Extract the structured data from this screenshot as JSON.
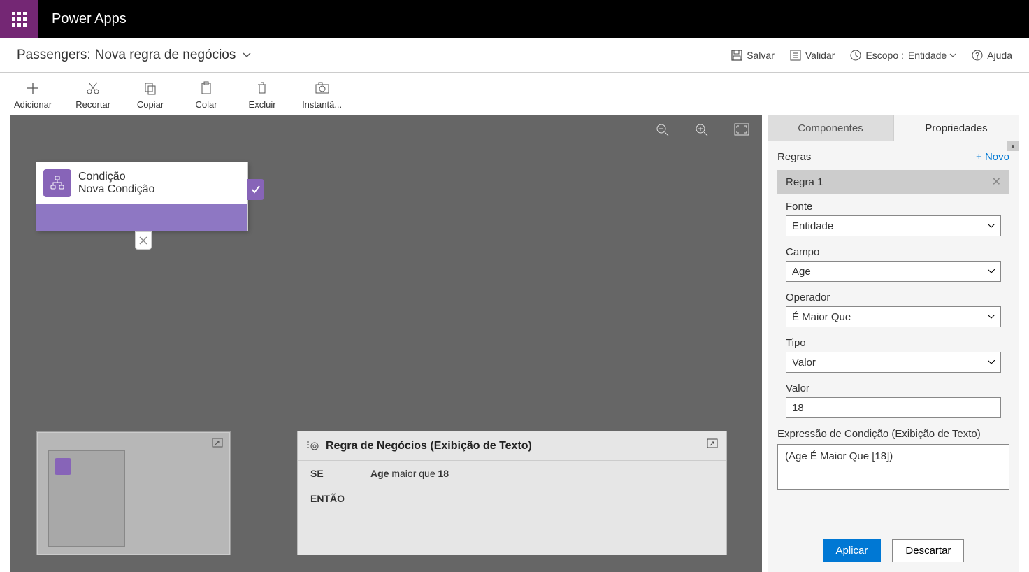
{
  "app": {
    "title": "Power Apps"
  },
  "breadcrumb": {
    "entity": "Passengers:",
    "rule": "Nova regra de negócios"
  },
  "topActions": {
    "save": "Salvar",
    "validate": "Validar",
    "scope_label": "Escopo :",
    "scope_value": "Entidade",
    "help": "Ajuda"
  },
  "toolbar": {
    "add": "Adicionar",
    "cut": "Recortar",
    "copy": "Copiar",
    "paste": "Colar",
    "delete": "Excluir",
    "snapshot": "Instantâ..."
  },
  "condition": {
    "title": "Condição",
    "subtitle": "Nova Condição"
  },
  "textRule": {
    "title": "Regra de Negócios (Exibição de Texto)",
    "se": "SE",
    "field": "Age",
    "op": "maior que",
    "value": "18",
    "entao": "ENTÃO"
  },
  "panel": {
    "tab_components": "Componentes",
    "tab_properties": "Propriedades",
    "rules_label": "Regras",
    "new_link": "+ Novo",
    "rule1": "Regra 1",
    "font_label": "Fonte",
    "font_value": "Entidade",
    "campo_label": "Campo",
    "campo_value": "Age",
    "operador_label": "Operador",
    "operador_value": "É Maior Que",
    "tipo_label": "Tipo",
    "tipo_value": "Valor",
    "valor_label": "Valor",
    "valor_value": "18",
    "expr_label": "Expressão de Condição (Exibição de Texto)",
    "expr_value": "(Age É Maior Que [18])",
    "apply": "Aplicar",
    "discard": "Descartar"
  }
}
